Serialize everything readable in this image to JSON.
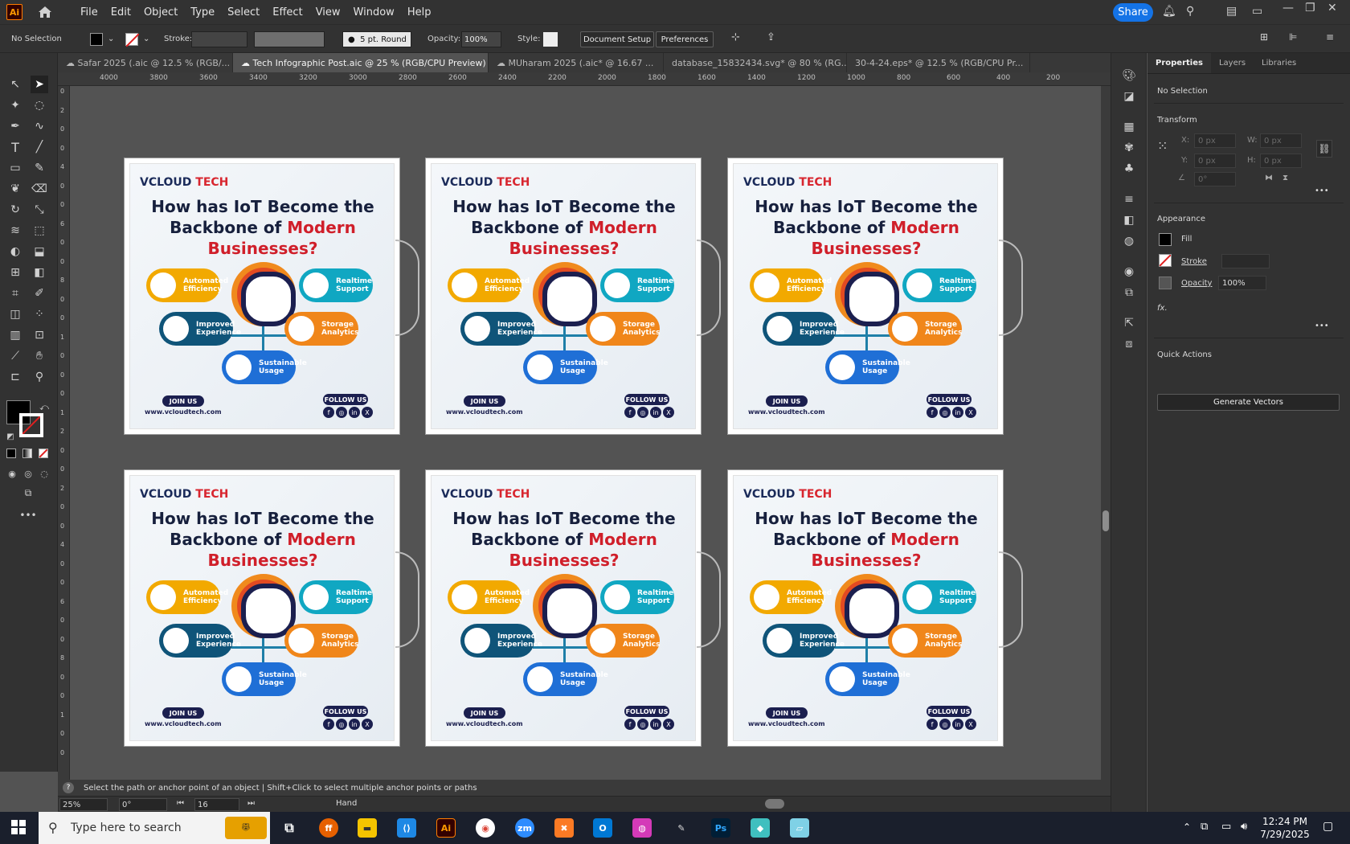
{
  "menubar": {
    "app_logo": "Ai",
    "menus": [
      "File",
      "Edit",
      "Object",
      "Type",
      "Select",
      "Effect",
      "View",
      "Window",
      "Help"
    ],
    "share_label": "Share"
  },
  "control_bar": {
    "selection": "No Selection",
    "stroke_label": "Stroke:",
    "brush": "5 pt. Round",
    "opacity_label": "Opacity:",
    "opacity_value": "100%",
    "style_label": "Style:",
    "document_setup": "Document Setup",
    "preferences": "Preferences"
  },
  "tabs": [
    {
      "label": "Safar 2025 (.aic @ 12.5 % (RGB/..."
    },
    {
      "label": "Tech Infographic Post.aic @ 25 % (RGB/CPU Preview)"
    },
    {
      "label": "MUharam 2025 (.aic* @ 16.67 ..."
    },
    {
      "label": "database_15832434.svg* @ 80 % (RG..."
    },
    {
      "label": "30-4-24.eps* @ 12.5 % (RGB/CPU Pr..."
    }
  ],
  "ruler_h": [
    "4000",
    "3800",
    "3600",
    "3400",
    "3200",
    "3000",
    "2800",
    "2600",
    "2400",
    "2200",
    "2000",
    "1800",
    "1600",
    "1400",
    "1200",
    "1000",
    "800",
    "600",
    "400",
    "200"
  ],
  "ruler_v": [
    "0",
    "2",
    "0",
    "0",
    "4",
    "0",
    "0",
    "6",
    "0",
    "0",
    "8",
    "0",
    "0",
    "1",
    "0",
    "0",
    "0",
    "1",
    "2",
    "0",
    "0",
    "2",
    "0",
    "0",
    "4",
    "0",
    "0",
    "6",
    "0",
    "0",
    "8",
    "0",
    "0",
    "1",
    "0",
    "0"
  ],
  "artboard": {
    "brand_main": "VCLOUD",
    "brand_accent": "TECH",
    "title_line1": "How has IoT Become the",
    "title_line2a": "Backbone of ",
    "title_line2b": "Modern",
    "title_line3": "Businesses?",
    "pills": [
      {
        "label": "Automated Efficiency",
        "color": "#f2a900"
      },
      {
        "label": "Realtime Support",
        "color": "#10a7c2"
      },
      {
        "label": "Improved Experience",
        "color": "#0f5479"
      },
      {
        "label": "Storage Analytics",
        "color": "#f0861a"
      },
      {
        "label": "Sustainable Usage",
        "color": "#1f6fd6"
      }
    ],
    "join": "JOIN US",
    "follow": "FOLLOW US",
    "url": "www.vcloudtech.com",
    "socials": [
      "f",
      "◎",
      "in",
      "X"
    ]
  },
  "status": {
    "message": "Select the path or anchor point of an object  |  Shift+Click to select multiple anchor points or paths",
    "zoom": "25%",
    "rotation": "0°",
    "artboard_num": "16",
    "tool": "Hand"
  },
  "panel": {
    "tabs": [
      "Properties",
      "Layers",
      "Libraries"
    ],
    "selection": "No Selection",
    "transform": "Transform",
    "x_label": "X:",
    "x_value": "0 px",
    "y_label": "Y:",
    "y_value": "0 px",
    "w_label": "W:",
    "w_value": "0 px",
    "h_label": "H:",
    "h_value": "0 px",
    "angle_value": "0°",
    "appearance": "Appearance",
    "fill_label": "Fill",
    "stroke_label": "Stroke",
    "opacity_label": "Opacity",
    "opacity_value": "100%",
    "fx_label": "fx.",
    "quick_actions": "Quick Actions",
    "generate_vectors": "Generate Vectors"
  },
  "taskbar": {
    "search_placeholder": "Type here to search",
    "time": "12:24 PM",
    "date": "7/29/2025"
  }
}
